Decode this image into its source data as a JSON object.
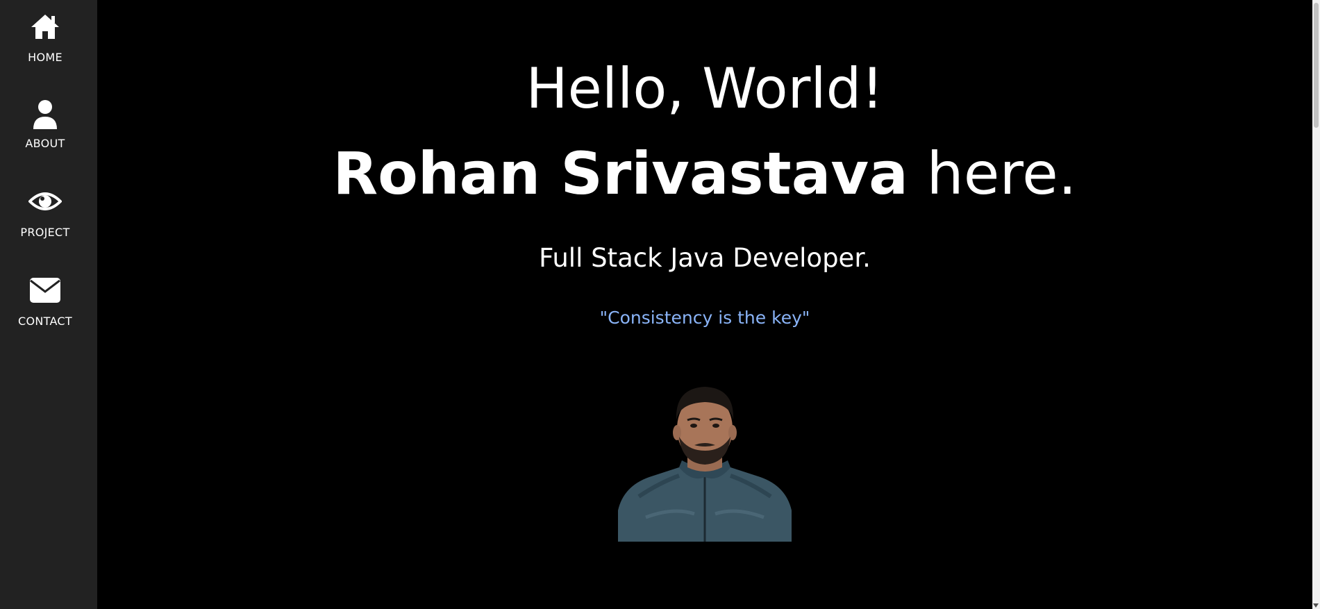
{
  "sidebar": {
    "items": [
      {
        "label": "HOME",
        "icon": "home-icon"
      },
      {
        "label": "ABOUT",
        "icon": "user-icon"
      },
      {
        "label": "PROJECT",
        "icon": "eye-icon"
      },
      {
        "label": "CONTACT",
        "icon": "envelope-icon"
      }
    ]
  },
  "hero": {
    "greeting": "Hello, World!",
    "name": "Rohan Srivastava",
    "name_suffix": " here.",
    "tagline": "Full Stack Java Developer.",
    "quote": "\"Consistency is the key\""
  },
  "colors": {
    "background": "#000000",
    "sidebar": "#222222",
    "text": "#ffffff",
    "quote": "#8ab4f8"
  }
}
